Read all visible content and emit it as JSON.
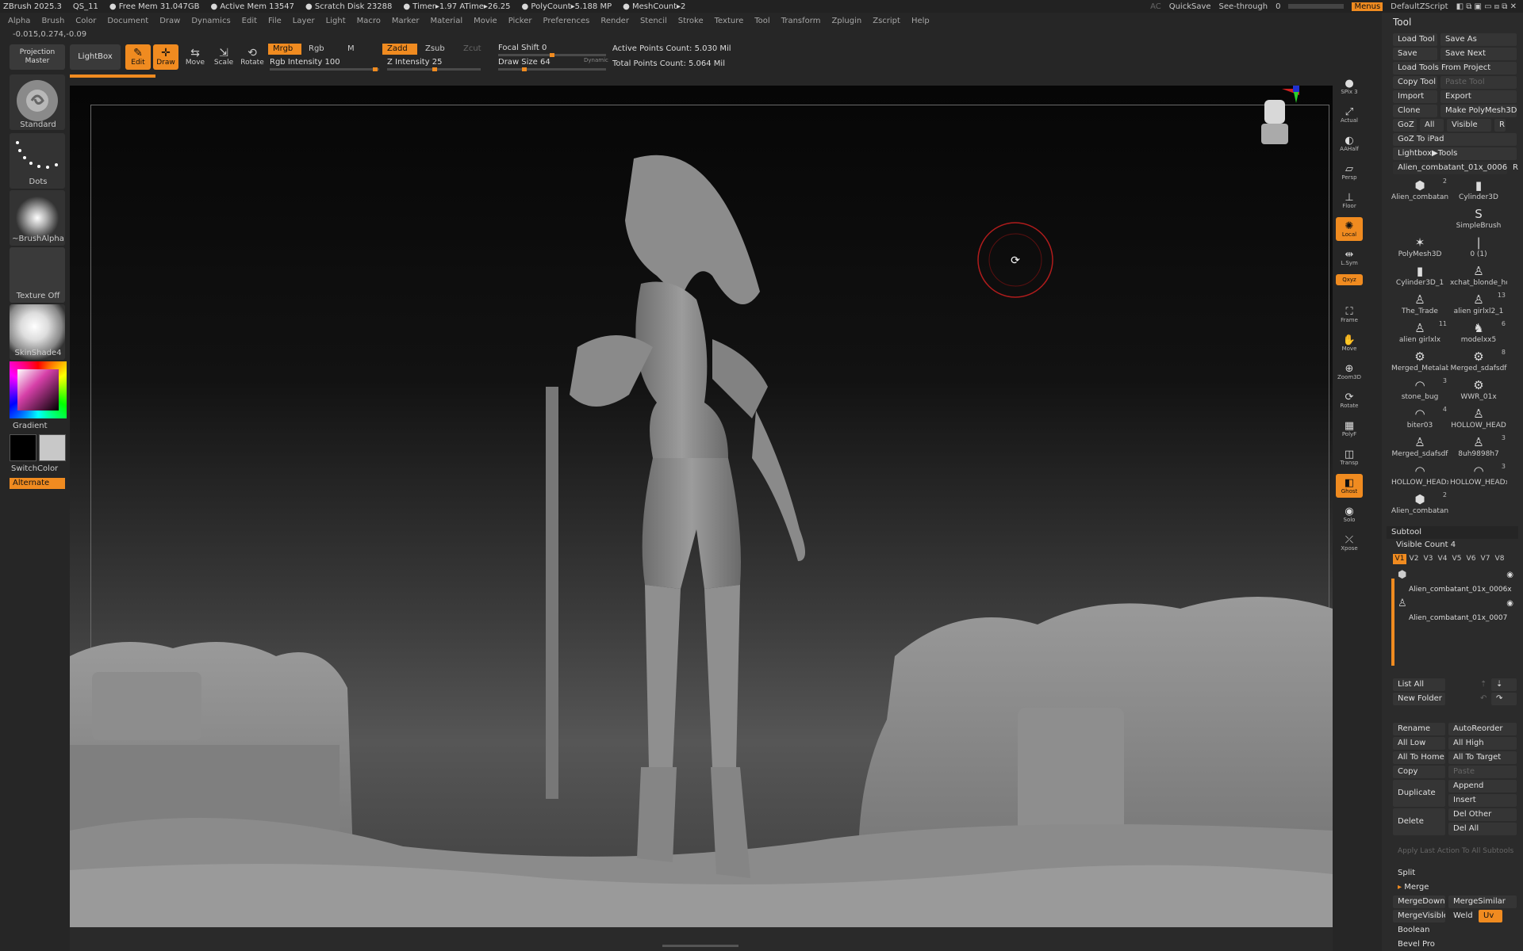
{
  "status": {
    "app": "ZBrush 2025.3",
    "project": "QS_11",
    "free_mem": "● Free Mem 31.047GB",
    "active_mem": "● Active Mem 13547",
    "scratch": "● Scratch Disk 23288",
    "timer": "● Timer▸1.97 ATime▸26.25",
    "polycount": "● PolyCount▸5.188 MP",
    "meshcount": "● MeshCount▸2",
    "ac": "AC",
    "quicksave": "QuickSave",
    "seethrough_label": "See-through",
    "seethrough_value": "0",
    "seethrough_fraction": 0.0,
    "menus": "Menus",
    "script": "DefaultZScript"
  },
  "menubar": [
    "Alpha",
    "Brush",
    "Color",
    "Document",
    "Draw",
    "Dynamics",
    "Edit",
    "File",
    "Layer",
    "Light",
    "Macro",
    "Marker",
    "Material",
    "Movie",
    "Picker",
    "Preferences",
    "Render",
    "Stencil",
    "Stroke",
    "Texture",
    "Tool",
    "Transform",
    "Zplugin",
    "Zscript",
    "Help"
  ],
  "coords": "-0.015,0.274,-0.09",
  "toolbar": {
    "projection_master": "Projection Master",
    "lightbox": "LightBox",
    "edit": "Edit",
    "draw": "Draw",
    "move": "Move",
    "scale": "Scale",
    "rotate": "Rotate",
    "mrgb": "Mrgb",
    "rgb": "Rgb",
    "m": "M",
    "rgb_intensity": "Rgb Intensity 100",
    "zadd": "Zadd",
    "zsub": "Zsub",
    "zcut": "Zcut",
    "z_intensity": "Z Intensity 25",
    "focal_shift": "Focal Shift 0",
    "draw_size": "Draw Size 64",
    "dynamic": "Dynamic",
    "active_points": "Active Points Count: 5.030 Mil",
    "total_points": "Total Points Count: 5.064 Mil"
  },
  "leftshelf": {
    "standard": "Standard",
    "dots": "Dots",
    "brushalpha": "~BrushAlpha",
    "texture": "Texture Off",
    "material": "SkinShade4",
    "gradient": "Gradient",
    "switchcolor": "SwitchColor",
    "alternate": "Alternate",
    "main_color": "#000000",
    "secondary_color": "#c8c8c8"
  },
  "rightshelf": [
    {
      "icon": "sphere-icon",
      "glyph": "●",
      "label": "SPix 3"
    },
    {
      "icon": "actual-icon",
      "glyph": "⤢",
      "label": "Actual"
    },
    {
      "icon": "aahalf-icon",
      "glyph": "◐",
      "label": "AAHalf"
    },
    {
      "icon": "persp-icon",
      "glyph": "▱",
      "label": "Persp"
    },
    {
      "icon": "floor-icon",
      "glyph": "⊥",
      "label": "Floor"
    },
    {
      "icon": "local-icon",
      "glyph": "✺",
      "label": "Local"
    },
    {
      "icon": "lsym-icon",
      "glyph": "⇹",
      "label": "L.Sym"
    },
    {
      "icon": "xyz-icon",
      "glyph": "⤧",
      "label": "Qxyz"
    },
    {
      "icon": "frame-icon",
      "glyph": "⛶",
      "label": "Frame"
    },
    {
      "icon": "move-icon",
      "glyph": "✋",
      "label": "Move"
    },
    {
      "icon": "zoom3d-icon",
      "glyph": "⊕",
      "label": "Zoom3D"
    },
    {
      "icon": "rotate-icon",
      "glyph": "⟳",
      "label": "Rotate"
    },
    {
      "icon": "polyf-icon",
      "glyph": "▦",
      "label": "PolyF"
    },
    {
      "icon": "transp-icon",
      "glyph": "◫",
      "label": "Transp"
    },
    {
      "icon": "ghost-icon",
      "glyph": "◧",
      "label": "Ghost"
    },
    {
      "icon": "solo-icon",
      "glyph": "◉",
      "label": "Solo"
    },
    {
      "icon": "xpose-icon",
      "glyph": "⤫",
      "label": "Xpose"
    }
  ],
  "tool": {
    "title": "Tool",
    "buttons": [
      [
        "Load Tool",
        "Save As"
      ],
      [
        "Save",
        "Save Next"
      ],
      [
        "Load Tools From Project"
      ],
      [
        "Copy Tool",
        "Paste Tool"
      ],
      [
        "Import",
        "Export"
      ],
      [
        "Clone",
        "Make PolyMesh3D"
      ],
      [
        "GoZ",
        "All",
        "Visible",
        "R"
      ],
      [
        "GoZ To iPad"
      ],
      [
        "Lightbox▶Tools"
      ]
    ],
    "current": "Alien_combatant_01x_0006x",
    "current_r": "R",
    "grid": [
      {
        "name": "Alien_combatant",
        "badge": "2",
        "glyph": "⬢"
      },
      {
        "name": "Cylinder3D",
        "badge": "",
        "glyph": "▮"
      },
      {
        "name": "",
        "badge": "",
        "glyph": ""
      },
      {
        "name": "SimpleBrush",
        "badge": "",
        "glyph": "S"
      },
      {
        "name": "PolyMesh3D",
        "badge": "",
        "glyph": "✶"
      },
      {
        "name": "0 (1)",
        "badge": "",
        "glyph": "❘"
      },
      {
        "name": "Cylinder3D_1",
        "badge": "",
        "glyph": "▮"
      },
      {
        "name": "xchat_blonde_ho",
        "badge": "",
        "glyph": "♙"
      },
      {
        "name": "The_Trade",
        "badge": "",
        "glyph": "♙"
      },
      {
        "name": "alien girlxl2_1",
        "badge": "13",
        "glyph": "♙"
      },
      {
        "name": "alien girlxlx",
        "badge": "11",
        "glyph": "♙"
      },
      {
        "name": "modelxx5",
        "badge": "6",
        "glyph": "♞"
      },
      {
        "name": "Merged_Metalab",
        "badge": "",
        "glyph": "⚙"
      },
      {
        "name": "Merged_sdafsdf",
        "badge": "8",
        "glyph": "⚙"
      },
      {
        "name": "stone_bug",
        "badge": "3",
        "glyph": "◠"
      },
      {
        "name": "WWR_01x",
        "badge": "",
        "glyph": "⚙"
      },
      {
        "name": "biter03",
        "badge": "4",
        "glyph": "◠"
      },
      {
        "name": "HOLLOW_HEAD",
        "badge": "",
        "glyph": "♙"
      },
      {
        "name": "Merged_sdafsdf",
        "badge": "",
        "glyph": "♙"
      },
      {
        "name": "8uh9898h7",
        "badge": "3",
        "glyph": "♙"
      },
      {
        "name": "HOLLOW_HEADx",
        "badge": "",
        "glyph": "◠"
      },
      {
        "name": "HOLLOW_HEADx",
        "badge": "3",
        "glyph": "◠"
      },
      {
        "name": "Alien_combatant",
        "badge": "2",
        "glyph": "⬢"
      }
    ],
    "subtool": {
      "header": "Subtool",
      "visible_count": "Visible Count 4",
      "vtabs": [
        "V1",
        "V2",
        "V3",
        "V4",
        "V5",
        "V6",
        "V7",
        "V8"
      ],
      "items": [
        "Alien_combatant_01x_0006x",
        "Alien_combatant_01x_0007"
      ],
      "list_all": "List All",
      "new_folder": "New Folder",
      "rename": "Rename",
      "autoreorder": "AutoReorder",
      "all_low": "All Low",
      "all_high": "All High",
      "all_to_home": "All To Home",
      "all_to_target": "All To Target",
      "copy": "Copy",
      "paste": "Paste",
      "append": "Append",
      "duplicate": "Duplicate",
      "insert": "Insert",
      "delete": "Delete",
      "del_other": "Del Other",
      "del_all": "Del All",
      "apply_last": "Apply Last Action To All Subtools",
      "split": "Split",
      "merge": "Merge",
      "mergedown": "MergeDown",
      "mergesimilar": "MergeSimilar",
      "mergevisible": "MergeVisible",
      "weld": "Weld",
      "uv": "Uv",
      "boolean": "Boolean",
      "bevel_pro": "Bevel Pro"
    }
  },
  "colors": {
    "accent": "#f08b20",
    "panel": "#2b2b2b",
    "background": "#262626"
  }
}
